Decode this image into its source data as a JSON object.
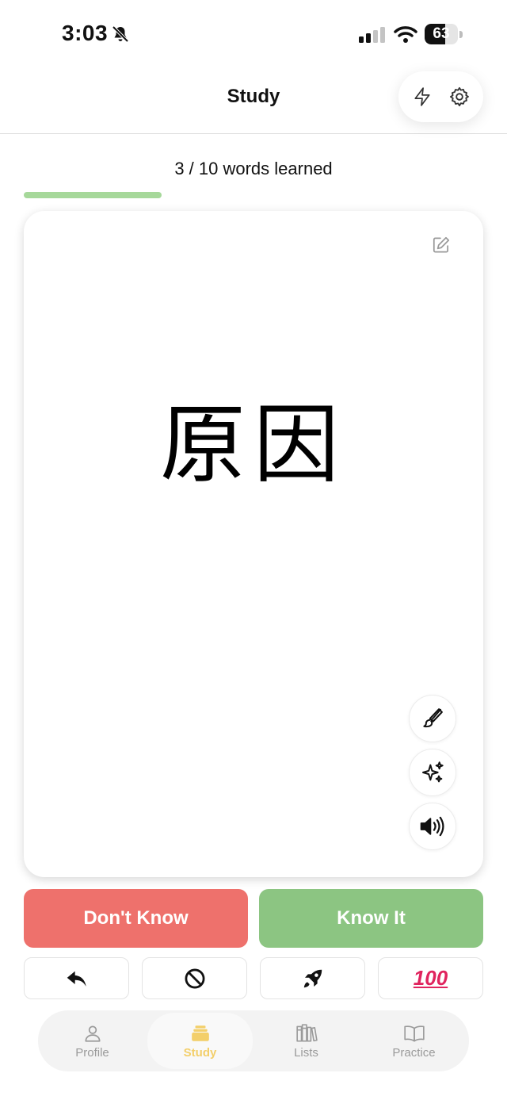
{
  "status_bar": {
    "time": "3:03",
    "battery": "63",
    "battery_level": 0.63,
    "icons": [
      "bell-slash-icon",
      "cellular-signal-icon",
      "wifi-icon",
      "battery-icon"
    ]
  },
  "header": {
    "title": "Study",
    "actions": [
      "lightning-icon",
      "gear-icon"
    ]
  },
  "progress": {
    "text": "3 / 10 words learned",
    "learned": 3,
    "total": 10,
    "color": "#a6d89a"
  },
  "card": {
    "word": "原因",
    "tools": [
      "edit-icon",
      "paintbrush-icon",
      "sparkles-icon",
      "speaker-icon"
    ]
  },
  "answers": {
    "dont_know": {
      "label": "Don't Know",
      "color": "#ee716c"
    },
    "know_it": {
      "label": "Know It",
      "color": "#8cc582"
    }
  },
  "actions": {
    "items": [
      "undo-arrow-icon",
      "prohibited-icon",
      "rocket-icon",
      "hundred-points-emoji"
    ],
    "hundred": "100"
  },
  "tabs": {
    "items": [
      {
        "label": "Profile",
        "icon": "person-icon",
        "active": false
      },
      {
        "label": "Study",
        "icon": "card-stack-icon",
        "active": true
      },
      {
        "label": "Lists",
        "icon": "books-icon",
        "active": false
      },
      {
        "label": "Practice",
        "icon": "open-book-icon",
        "active": false
      }
    ],
    "active_color": "#f3cf6a",
    "inactive_color": "#9a9a9a"
  }
}
